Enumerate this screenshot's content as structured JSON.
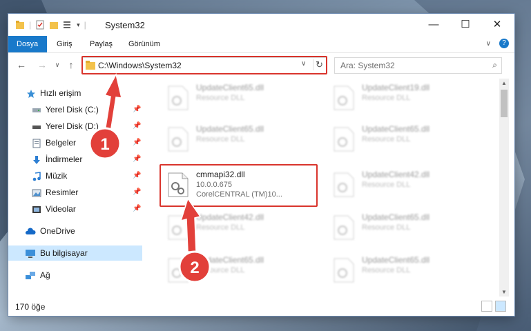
{
  "window": {
    "title": "System32"
  },
  "ribbon": {
    "tabs": [
      "Dosya",
      "Giriş",
      "Paylaş",
      "Görünüm"
    ]
  },
  "address": {
    "path": "C:\\Windows\\System32"
  },
  "search": {
    "placeholder": "Ara: System32"
  },
  "sidebar": {
    "items": [
      {
        "label": "Hızlı erişim",
        "icon": "star-icon"
      },
      {
        "label": "Yerel Disk (C:)",
        "icon": "drive-icon",
        "pinned": true
      },
      {
        "label": "Yerel Disk (D:)",
        "icon": "drive-icon",
        "pinned": true
      },
      {
        "label": "Belgeler",
        "icon": "document-icon",
        "pinned": true
      },
      {
        "label": "İndirmeler",
        "icon": "download-icon",
        "pinned": true
      },
      {
        "label": "Müzik",
        "icon": "music-icon",
        "pinned": true
      },
      {
        "label": "Resimler",
        "icon": "pictures-icon",
        "pinned": true
      },
      {
        "label": "Videolar",
        "icon": "video-icon",
        "pinned": true
      },
      {
        "label": "OneDrive",
        "icon": "cloud-icon"
      },
      {
        "label": "Bu bilgisayar",
        "icon": "computer-icon",
        "selected": true
      },
      {
        "label": "Ağ",
        "icon": "network-icon"
      }
    ]
  },
  "files": [
    {
      "name": "UpdateClient65.dll",
      "line2": "Resource DLL"
    },
    {
      "name": "UpdateClient19.dll",
      "line2": "Resource DLL"
    },
    {
      "name": "UpdateClient65.dll",
      "line2": "Resource DLL"
    },
    {
      "name": "UpdateClient65.dll",
      "line2": "Resource DLL"
    },
    {
      "name": "cmmapi32.dll",
      "line2": "10.0.0.675",
      "line3": "CorelCENTRAL (TM)10...",
      "highlighted": true
    },
    {
      "name": "UpdateClient42.dll",
      "line2": "Resource DLL"
    },
    {
      "name": "UpdateClient42.dll",
      "line2": "Resource DLL"
    },
    {
      "name": "UpdateClient65.dll",
      "line2": "Resource DLL"
    },
    {
      "name": "UpdateClient65.dll",
      "line2": "Resource DLL"
    },
    {
      "name": "UpdateClient65.dll",
      "line2": "Resource DLL"
    }
  ],
  "status": {
    "item_count": "170 öğe"
  },
  "annotations": {
    "step1": "1",
    "step2": "2"
  },
  "colors": {
    "accent": "#1979ca",
    "highlight": "#d9342c",
    "selected": "#cce8ff"
  }
}
